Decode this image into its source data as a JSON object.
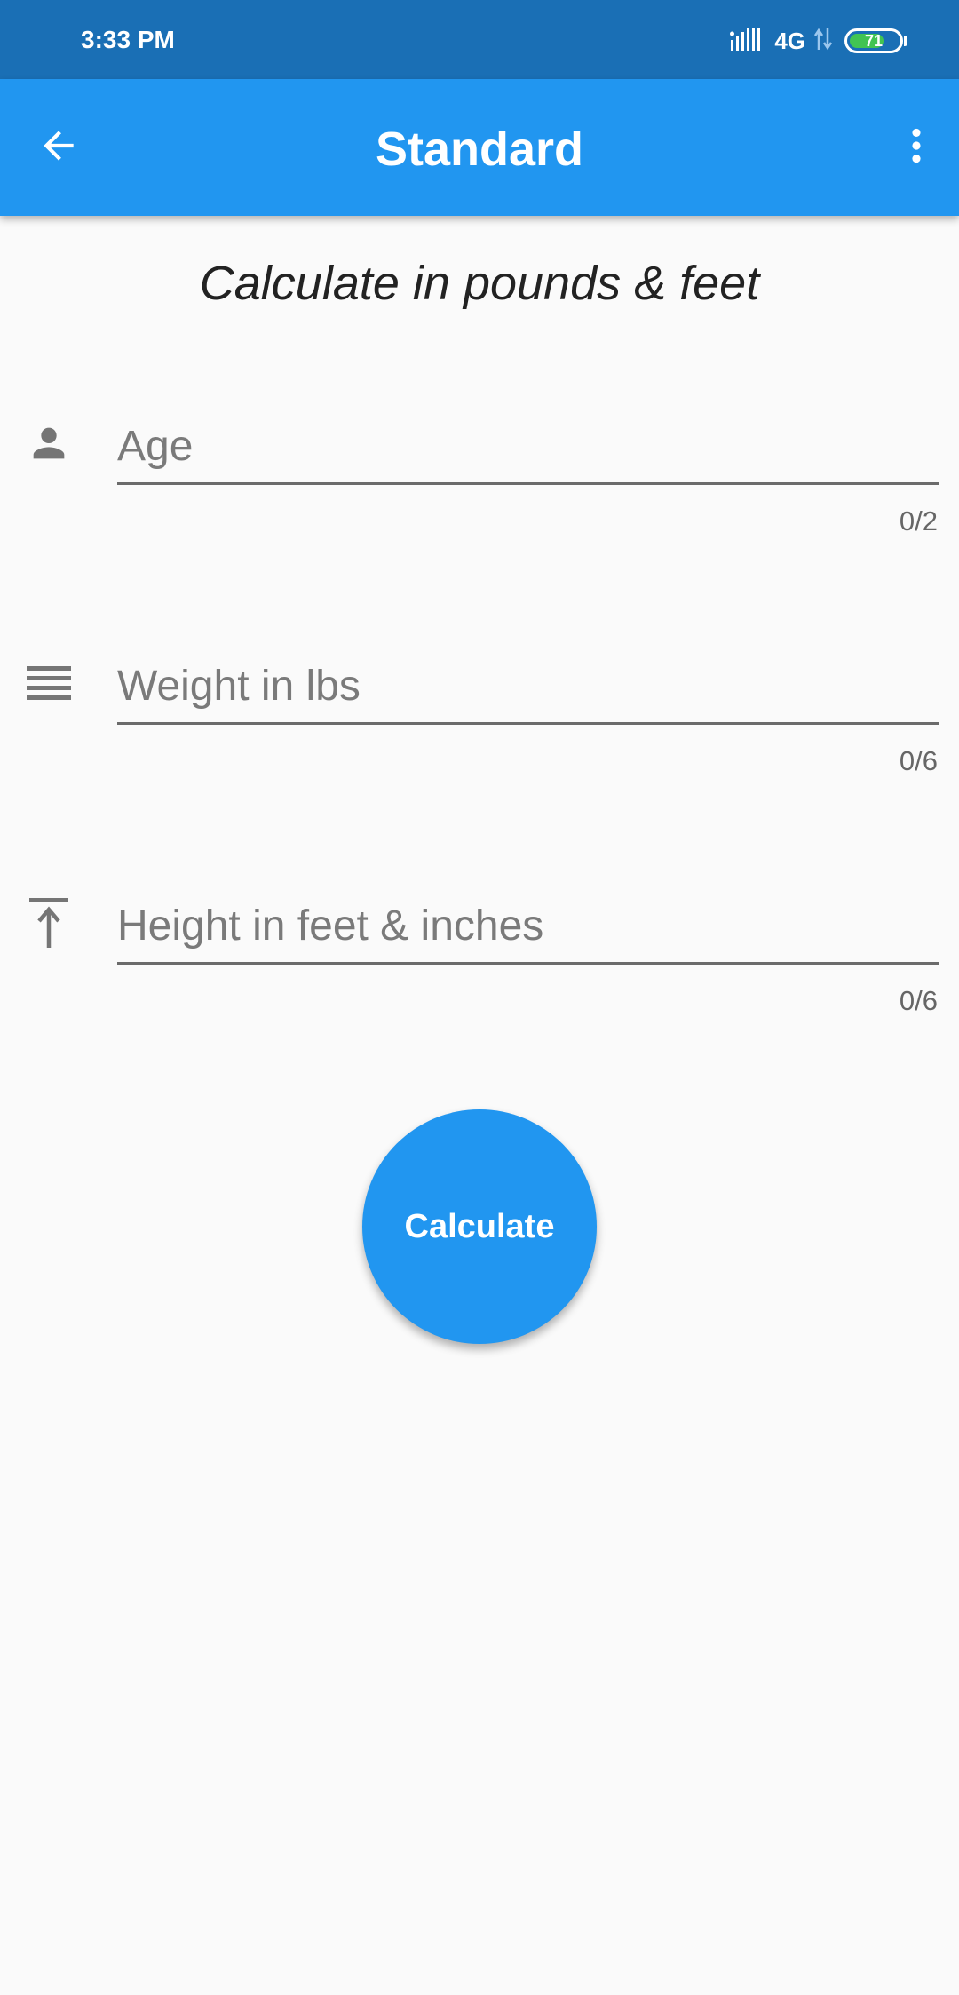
{
  "status_bar": {
    "time": "3:33 PM",
    "network": "4G",
    "battery_level": "71",
    "battery_fraction": 0.71,
    "icons": [
      "signal-bars-icon",
      "data-arrows-icon",
      "battery-icon"
    ]
  },
  "app_bar": {
    "title": "Standard",
    "left_icon": "back-arrow-icon",
    "right_icon": "more-vert-icon"
  },
  "subtitle": "Calculate in pounds & feet",
  "fields": [
    {
      "icon": "person-icon",
      "placeholder": "Age",
      "value": "",
      "counter": "0/2"
    },
    {
      "icon": "weight-icon",
      "placeholder": "Weight in lbs",
      "value": "",
      "counter": "0/6"
    },
    {
      "icon": "height-icon",
      "placeholder": "Height in feet & inches",
      "value": "",
      "counter": "0/6"
    }
  ],
  "calculate_button": {
    "label": "Calculate"
  },
  "colors": {
    "status_bar": "#1a6fb5",
    "primary": "#2196f0",
    "background": "#fafafa",
    "icon_gray": "#757575",
    "battery_green": "#41c452"
  }
}
